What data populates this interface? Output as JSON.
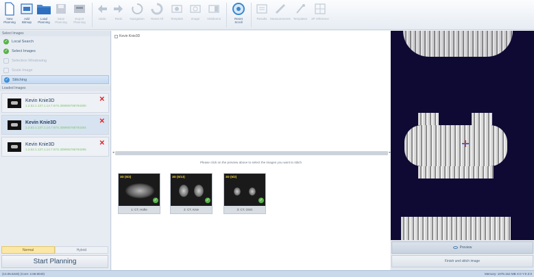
{
  "ribbon": {
    "buttons": [
      {
        "label": "New\nPlanning",
        "icon": "new-document-icon",
        "disabled": false
      },
      {
        "label": "Add\nBitmap",
        "icon": "add-bitmap-icon",
        "disabled": false
      },
      {
        "label": "Load\nPlanning",
        "icon": "folder-icon",
        "disabled": false
      },
      {
        "label": "Save\nPlanning",
        "icon": "save-icon",
        "disabled": true
      },
      {
        "label": "Export\nPlanning",
        "icon": "export-icon",
        "disabled": true
      },
      {
        "label": "Undo",
        "icon": "undo-icon",
        "disabled": true
      },
      {
        "label": "Redo",
        "icon": "redo-icon",
        "disabled": true
      },
      {
        "label": "Navigation",
        "icon": "navigation-icon",
        "disabled": true
      },
      {
        "label": "Reset All",
        "icon": "reset-all-icon",
        "disabled": true
      },
      {
        "label": "Template",
        "icon": "template-icon",
        "disabled": true
      },
      {
        "label": "Image",
        "icon": "image-icon",
        "disabled": true
      },
      {
        "label": "Vieldrums",
        "icon": "views-icon",
        "disabled": true
      },
      {
        "label": "Reset\nScroll",
        "icon": "reset-scroll-icon",
        "disabled": false
      },
      {
        "label": "Results",
        "icon": "results-icon",
        "disabled": true
      },
      {
        "label": "Measurements",
        "icon": "measurements-icon",
        "disabled": true
      },
      {
        "label": "Templates",
        "icon": "templates-icon",
        "disabled": true
      },
      {
        "label": "3P reference",
        "icon": "reference-icon",
        "disabled": true
      }
    ]
  },
  "left": {
    "steps_header": "Select Images",
    "steps": [
      {
        "label": "Local Search",
        "state": "done"
      },
      {
        "label": "Select Images",
        "state": "done"
      },
      {
        "label": "Selection Windowing",
        "state": "off"
      },
      {
        "label": "Scale Image",
        "state": "off"
      },
      {
        "label": "Stitching",
        "state": "active"
      }
    ],
    "loaded_header": "Loaded Images",
    "patients": [
      {
        "name": "Kevin Knie3D",
        "uid": "1.2.52.1.137.1.14.7.67S.309906786784280",
        "selected": false
      },
      {
        "name": "Kevin Knie3D",
        "uid": "1.2.52.1.137.1.14.7.67S.309906786784284",
        "selected": true
      },
      {
        "name": "Kevin Knie3D",
        "uid": "1.2.52.1.137.1.14.7.67S.309906786784285",
        "selected": false
      }
    ],
    "mode_tabs": [
      "Normal",
      "Hybrid"
    ],
    "start_button": "Start Planning"
  },
  "center": {
    "checkbox_label": "Kevin Knie3D",
    "hint": "Please click on the preview above to select the images you want to stitch",
    "series": [
      {
        "tag": "3D (5/2)",
        "caption": "1: CT, Hüfte",
        "kind": "hip"
      },
      {
        "tag": "3D (5/13)",
        "caption": "2: CT, Knie",
        "kind": "knee"
      },
      {
        "tag": "3D (5/2)",
        "caption": "3: CT, OSG",
        "kind": "ankle"
      }
    ]
  },
  "right": {
    "preview_button": "Preview",
    "finish_button": "Finish und stitch image"
  },
  "status": {
    "left": "(13.05.5246) (Core: 2.58.8040)",
    "right": "Memory: 1078.152 MB  X:0 Y:0 Z:0"
  },
  "colors": {
    "accent_green": "#58b24a",
    "delete_red": "#e0222a",
    "viewer_bg": "#0f0a33",
    "tab_active": "#fbe7a6"
  }
}
